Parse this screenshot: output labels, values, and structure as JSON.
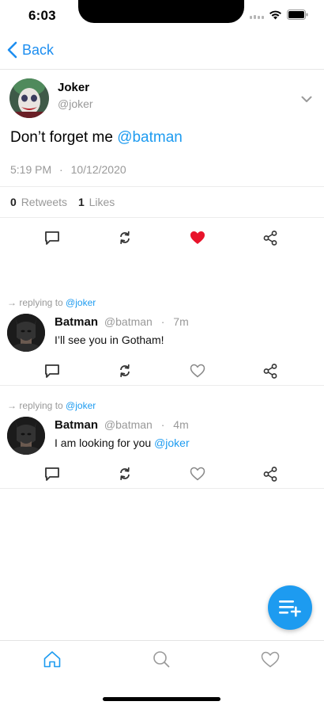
{
  "status_bar": {
    "time": "6:03"
  },
  "nav": {
    "back_label": "Back"
  },
  "tweet": {
    "author_name": "Joker",
    "author_handle": "@joker",
    "text": "Don’t forget me",
    "mention": "@batman",
    "time": "5:19 PM",
    "separator": "·",
    "date": "10/12/2020",
    "retweets_count": "0",
    "retweets_label": "Retweets",
    "likes_count": "1",
    "likes_label": "Likes",
    "liked": true
  },
  "replies": [
    {
      "context_prefix": "→ replying to",
      "context_handle": "@joker",
      "name": "Batman",
      "handle": "@batman",
      "separator": "·",
      "time": "7m",
      "text": "I’ll see you in Gotham!",
      "mention": ""
    },
    {
      "context_prefix": "→ replying to",
      "context_handle": "@joker",
      "name": "Batman",
      "handle": "@batman",
      "separator": "·",
      "time": "4m",
      "text": "I am looking for you",
      "mention": "@joker"
    }
  ],
  "colors": {
    "accent": "#1d9bf0",
    "like_active": "#e8132b",
    "muted": "#999999"
  },
  "icons": {
    "back": "chevron-left-icon",
    "more": "chevron-down-icon",
    "reply": "comment-icon",
    "retweet": "retweet-icon",
    "like": "heart-icon",
    "share": "share-icon",
    "compose": "compose-icon",
    "tab_home": "home-icon",
    "tab_search": "search-icon",
    "tab_likes": "heart-icon"
  }
}
